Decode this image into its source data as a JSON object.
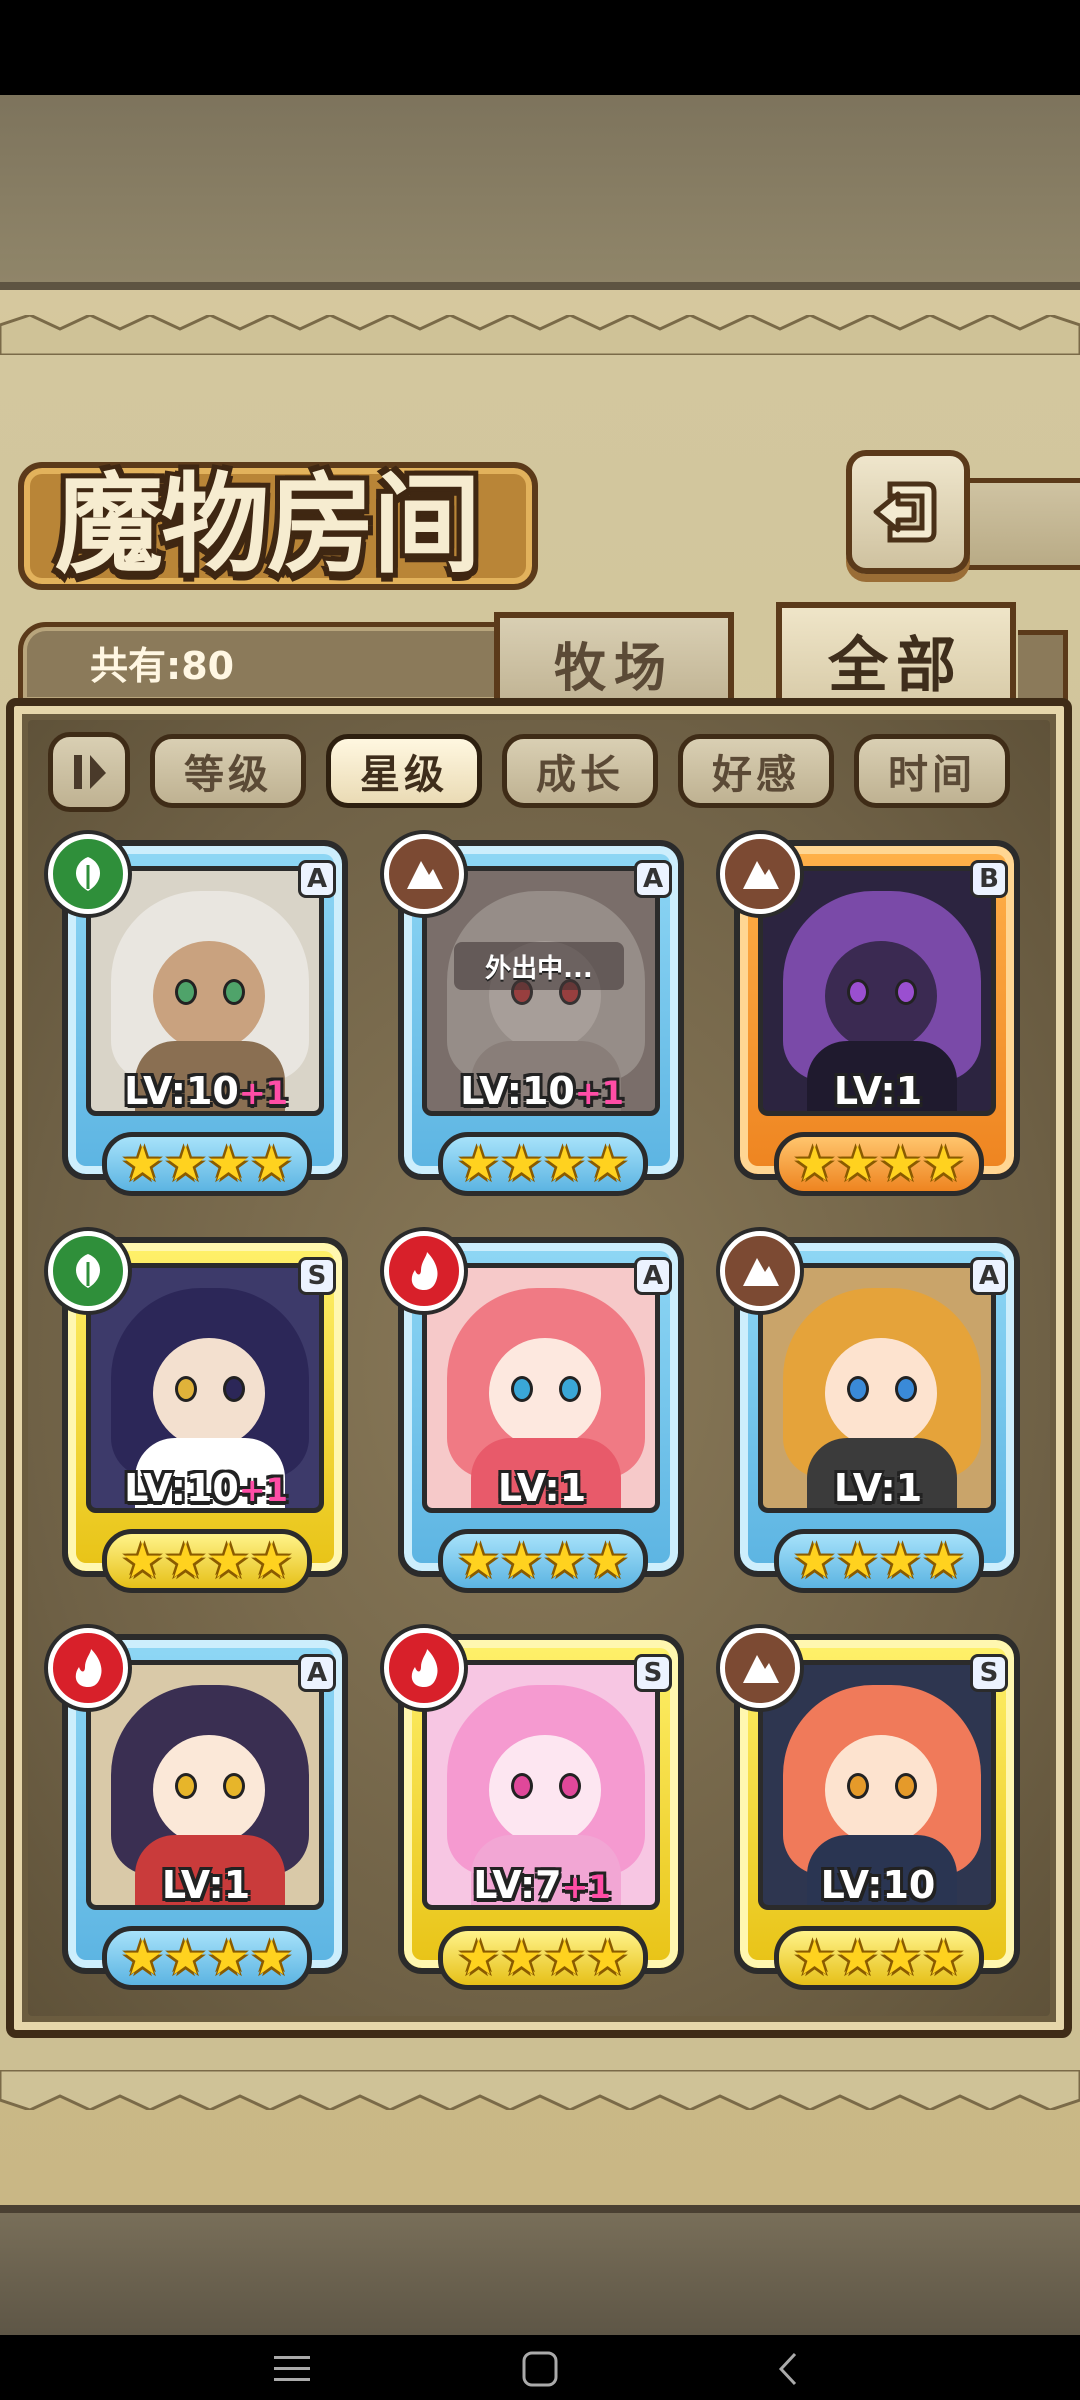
{
  "header": {
    "title": "魔物房间",
    "count_label": "共有:80"
  },
  "tabs": {
    "ranch": "牧场",
    "all": "全部"
  },
  "sort": {
    "buttons": [
      "等级",
      "星级",
      "成长",
      "好感",
      "时间"
    ],
    "active": "星级"
  },
  "monsters": [
    {
      "element": "wood",
      "rank": "A",
      "level": "LV:10",
      "plus": "+1",
      "stars": "★★★★",
      "frame": "blue",
      "away": ""
    },
    {
      "element": "rock",
      "rank": "A",
      "level": "LV:10",
      "plus": "+1",
      "stars": "★★★★",
      "frame": "blue",
      "away": "外出中..."
    },
    {
      "element": "rock",
      "rank": "B",
      "level": "LV:1",
      "plus": "",
      "stars": "★★★★",
      "frame": "orange",
      "away": ""
    },
    {
      "element": "wood",
      "rank": "S",
      "level": "LV:10",
      "plus": "+1",
      "stars": "★★★★",
      "frame": "gold",
      "away": ""
    },
    {
      "element": "fire",
      "rank": "A",
      "level": "LV:1",
      "plus": "",
      "stars": "★★★★",
      "frame": "blue",
      "away": ""
    },
    {
      "element": "rock",
      "rank": "A",
      "level": "LV:1",
      "plus": "",
      "stars": "★★★★",
      "frame": "blue",
      "away": ""
    },
    {
      "element": "fire",
      "rank": "A",
      "level": "LV:1",
      "plus": "",
      "stars": "★★★★",
      "frame": "blue",
      "away": ""
    },
    {
      "element": "fire",
      "rank": "S",
      "level": "LV:7",
      "plus": "+1",
      "stars": "★★★★",
      "frame": "gold",
      "away": ""
    },
    {
      "element": "rock",
      "rank": "S",
      "level": "LV:10",
      "plus": "",
      "stars": "★★★★",
      "frame": "gold",
      "away": ""
    }
  ],
  "icons": {
    "back": "return-arrow-icon",
    "sort_toggle": "sort-order-icon",
    "wood": "leaf-icon",
    "rock": "rock-icon",
    "fire": "flame-icon"
  },
  "colors": {
    "frame_blue": "#5cb4e2",
    "frame_gold": "#e8c316",
    "frame_orange": "#ee8420",
    "element_wood": "#2f8f3a",
    "element_rock": "#7c4a33",
    "element_fire": "#d8202a",
    "plus_level": "#ff4da6",
    "star": "#ffd21f"
  },
  "navigation": {
    "buttons": [
      "menu",
      "home",
      "back"
    ]
  }
}
